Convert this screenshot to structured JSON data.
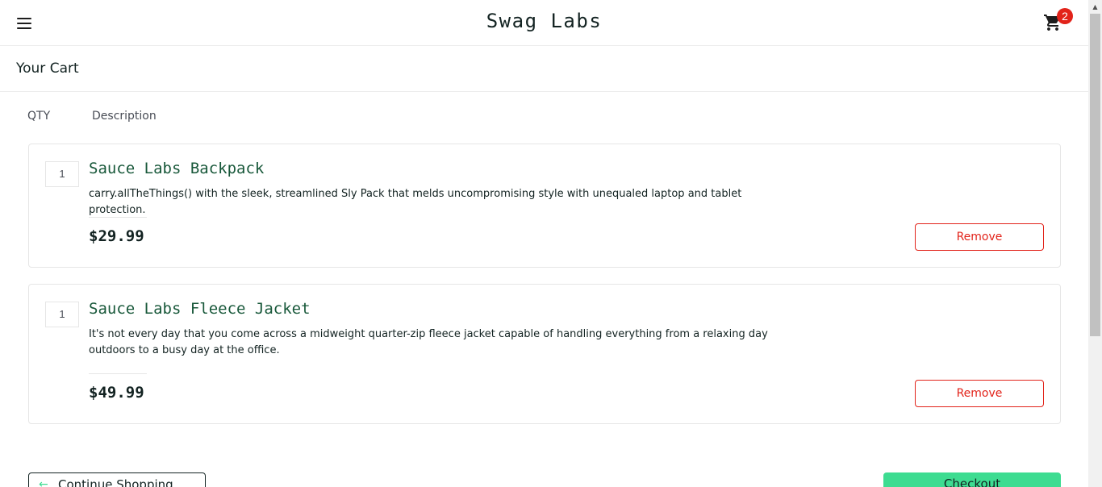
{
  "header": {
    "title": "Swag Labs",
    "cart_count": "2",
    "badge_color": "#e2231a"
  },
  "page": {
    "title": "Your Cart"
  },
  "cart": {
    "qty_label": "QTY",
    "desc_label": "Description",
    "items": [
      {
        "qty": "1",
        "name": "Sauce Labs Backpack",
        "description": "carry.allTheThings() with the sleek, streamlined Sly Pack that melds uncompromising style with unequaled laptop and tablet protection.",
        "price": "$29.99",
        "remove_label": "Remove"
      },
      {
        "qty": "1",
        "name": "Sauce Labs Fleece Jacket",
        "description": "It's not every day that you come across a midweight quarter-zip fleece jacket capable of handling everything from a relaxing day outdoors to a busy day at the office.",
        "price": "$49.99",
        "remove_label": "Remove"
      }
    ]
  },
  "footer": {
    "continue_label": "Continue Shopping",
    "checkout_label": "Checkout"
  },
  "colors": {
    "accent": "#3ddc91",
    "item_name": "#18583a",
    "remove": "#e2231a"
  },
  "icons": {
    "menu": "hamburger-menu-icon",
    "cart": "shopping-cart-icon",
    "back": "arrow-left-icon"
  }
}
